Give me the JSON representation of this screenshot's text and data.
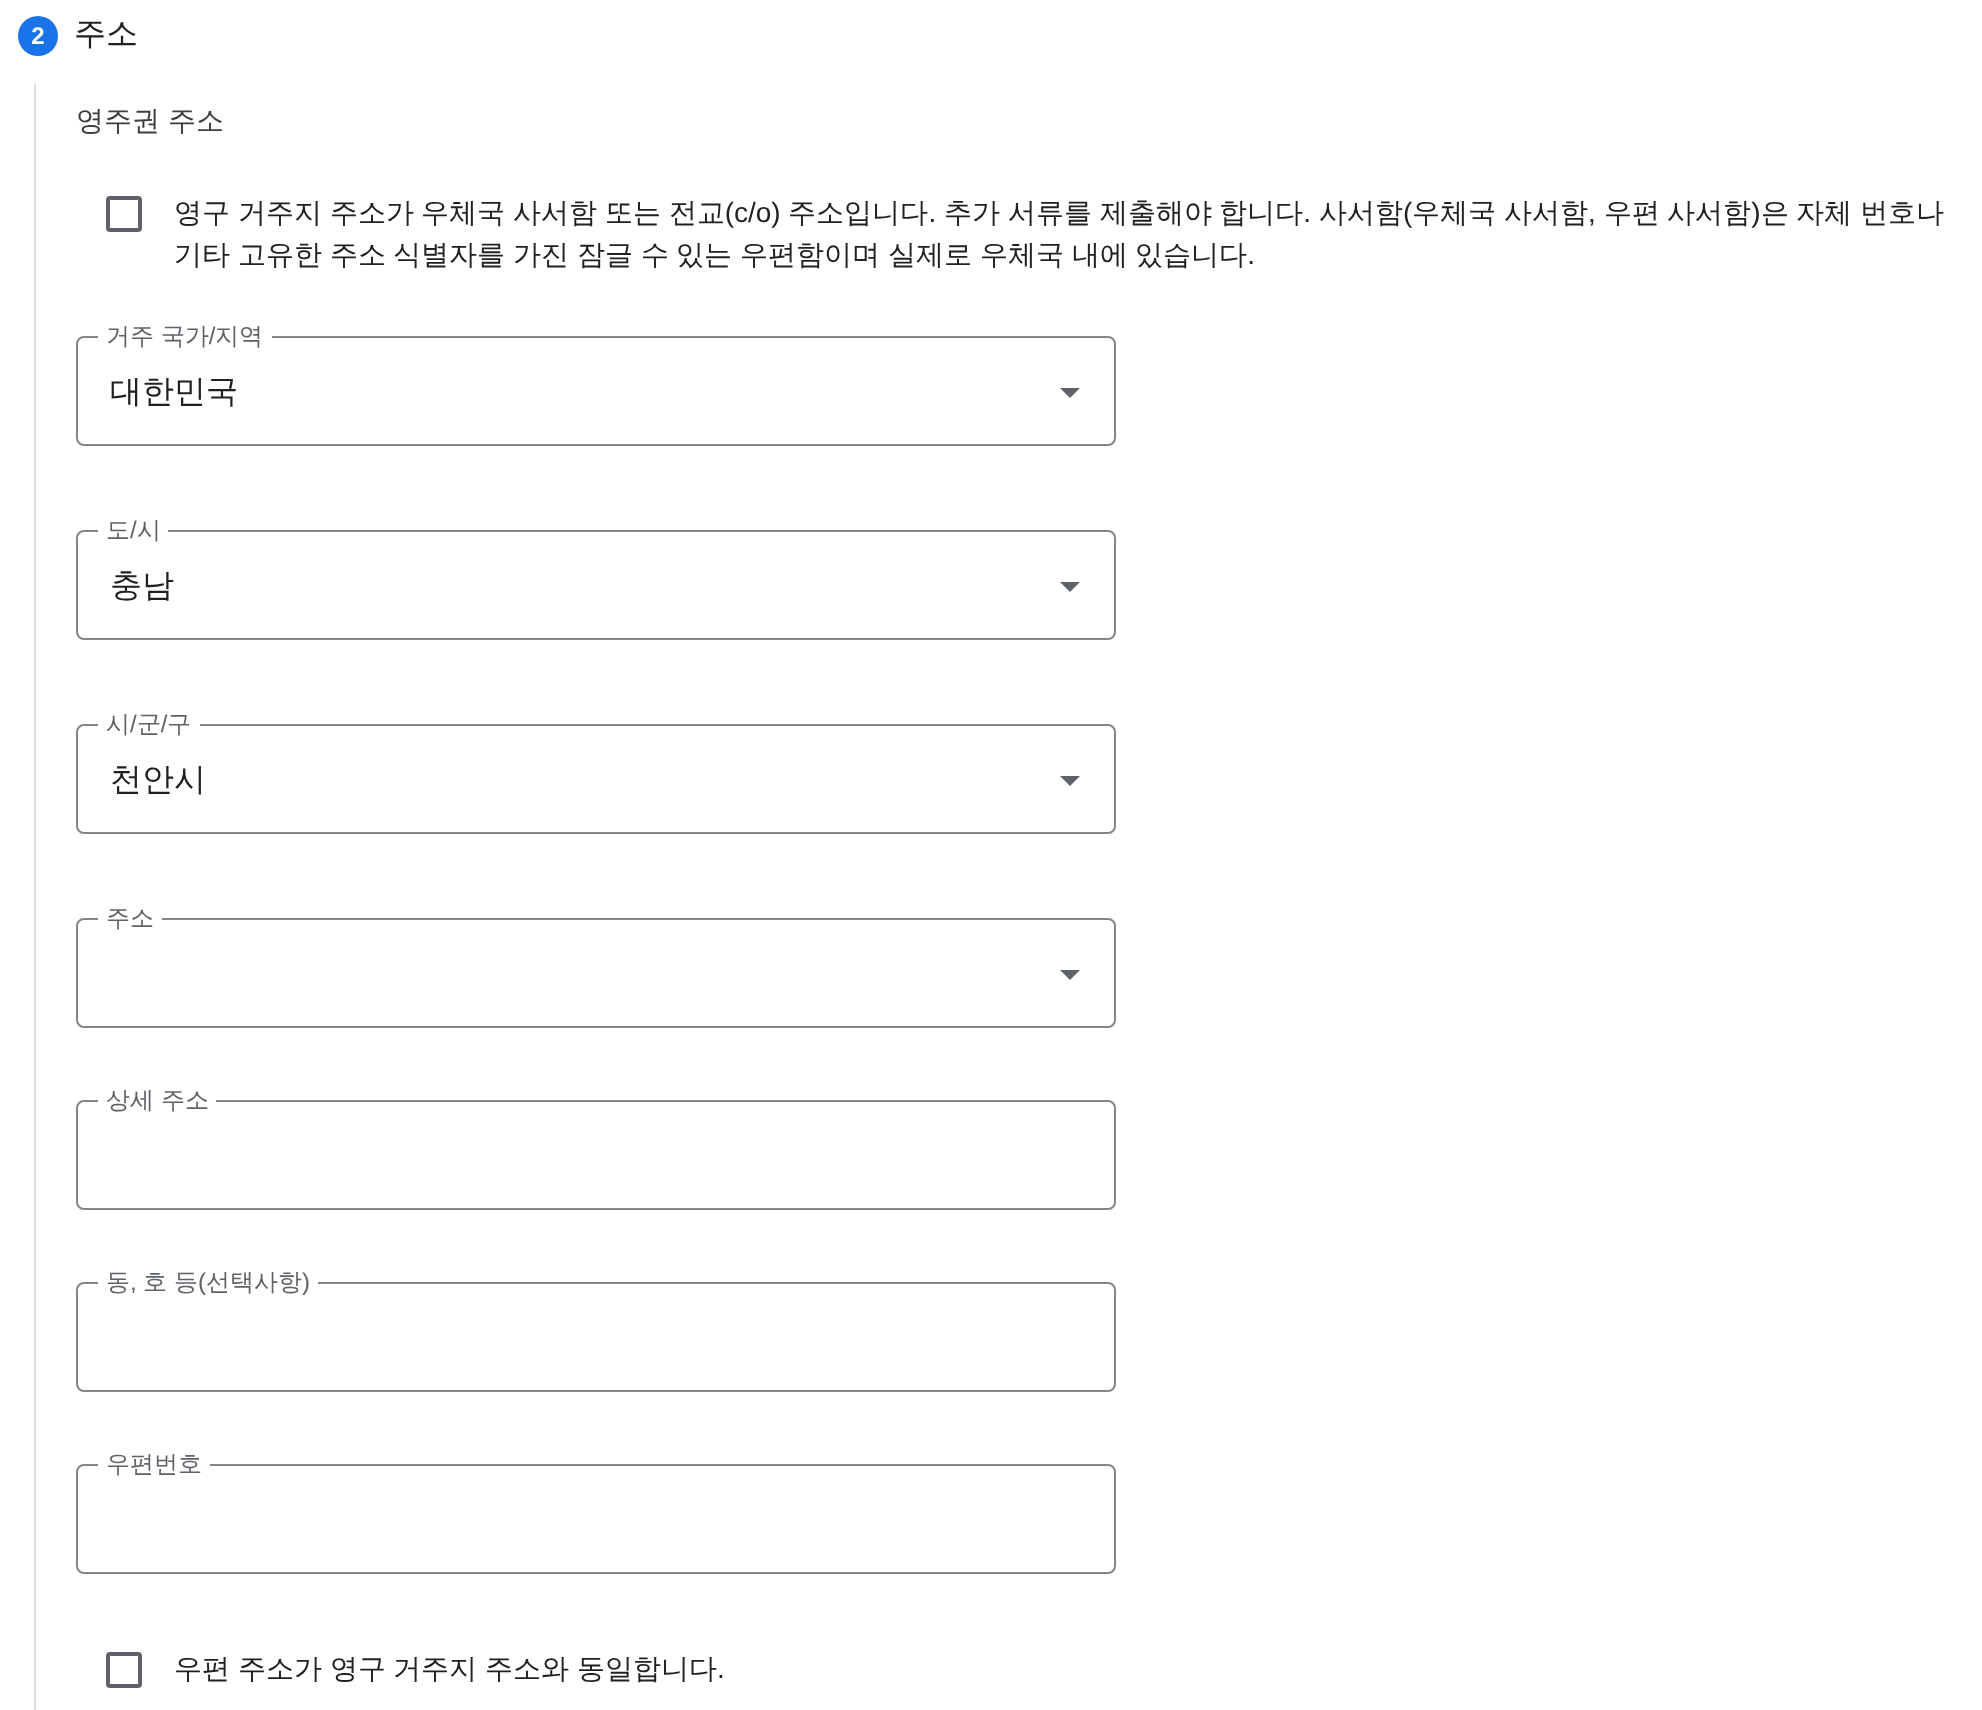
{
  "step": {
    "number": "2",
    "title": "주소"
  },
  "section": {
    "title": "영주권 주소",
    "po_box_checkbox": {
      "label": "영구 거주지 주소가 우체국 사서함 또는 전교(c/o) 주소입니다. 추가 서류를 제출해야 합니다. 사서함(우체국 사서함, 우편 사서함)은 자체 번호나 기타 고유한 주소 식별자를 가진 잠글 수 있는 우편함이며 실제로 우체국 내에 있습니다.",
      "checked": false
    },
    "fields": [
      {
        "kind": "select",
        "label": "거주 국가/지역",
        "value": "대한민국"
      },
      {
        "kind": "select",
        "label": "도/시",
        "value": "충남"
      },
      {
        "kind": "select",
        "label": "시/군/구",
        "value": "천안시"
      },
      {
        "kind": "select",
        "label": "주소"
      },
      {
        "kind": "text",
        "label": "상세 주소"
      },
      {
        "kind": "text",
        "label": "동, 호 등(선택사항)"
      },
      {
        "kind": "text",
        "label": "우편번호"
      }
    ],
    "same_address_checkbox": {
      "label": "우편 주소가 영구 거주지 주소와 동일합니다.",
      "checked": false
    }
  }
}
